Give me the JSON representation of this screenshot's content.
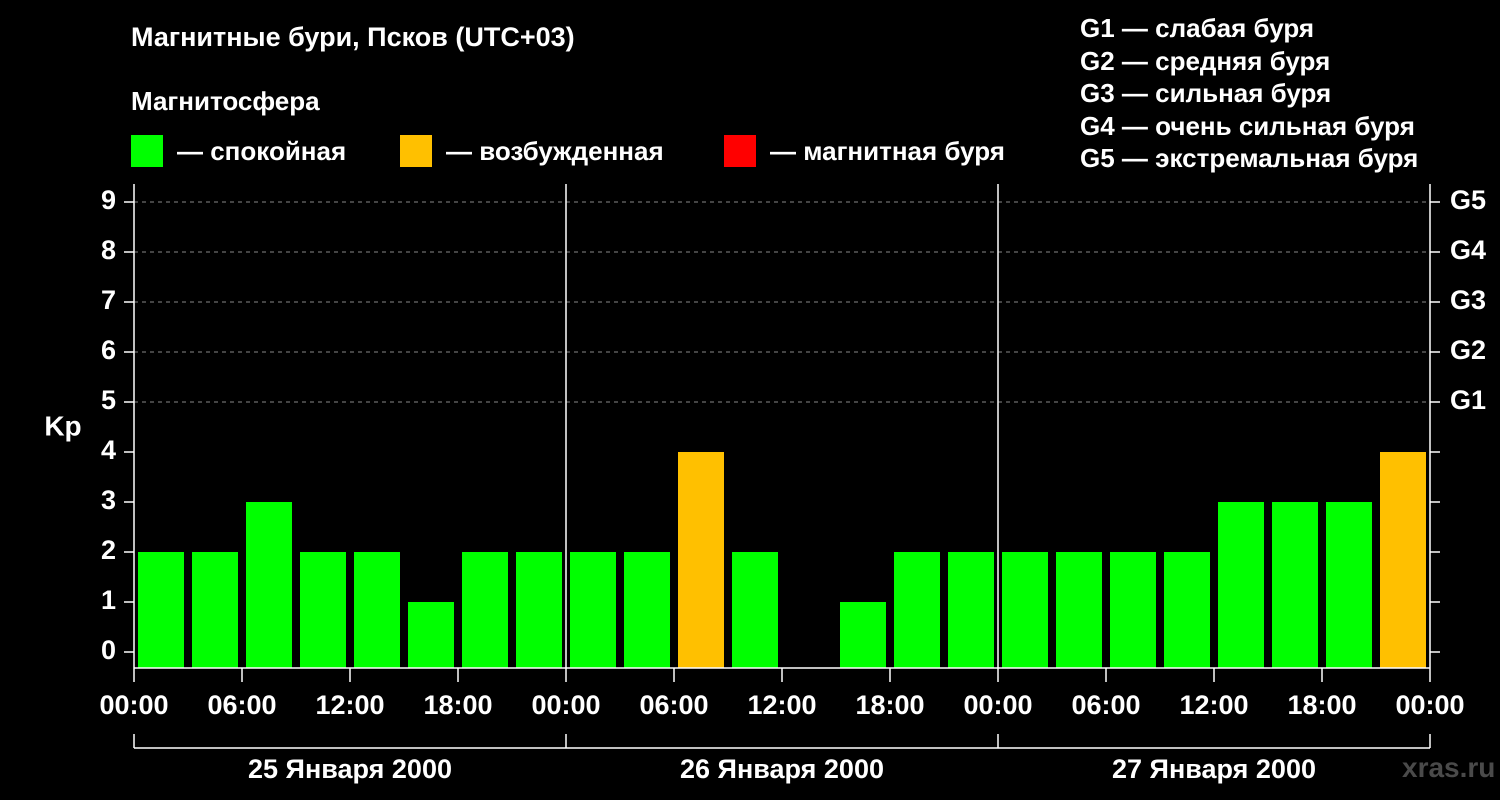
{
  "title": "Магнитные бури, Псков (UTC+03)",
  "subtitle": "Магнитосфера",
  "colors": {
    "background": "#000000",
    "calm": "#00ff00",
    "excited": "#ffc000",
    "storm": "#ff0000",
    "text": "#ffffff",
    "watermark": "#4a4a4a"
  },
  "legend": [
    {
      "label": "— спокойная",
      "color": "#00ff00"
    },
    {
      "label": "— возбужденная",
      "color": "#ffc000"
    },
    {
      "label": "— магнитная буря",
      "color": "#ff0000"
    }
  ],
  "storm_levels": [
    "G1 — слабая буря",
    "G2 — средняя буря",
    "G3 — сильная буря",
    "G4 — очень сильная буря",
    "G5 — экстремальная буря"
  ],
  "watermark": "xras.ru",
  "chart_data": {
    "type": "bar",
    "ylabel": "Kp",
    "ylim": [
      0,
      9
    ],
    "yticks": [
      "0",
      "1",
      "2",
      "3",
      "4",
      "5",
      "6",
      "7",
      "8",
      "9"
    ],
    "right_ticks": [
      {
        "value": 5,
        "label": "G1"
      },
      {
        "value": 6,
        "label": "G2"
      },
      {
        "value": 7,
        "label": "G3"
      },
      {
        "value": 8,
        "label": "G4"
      },
      {
        "value": 9,
        "label": "G5"
      }
    ],
    "grid": "horizontal dashed at Kp 5–9",
    "xticks": [
      "00:00",
      "06:00",
      "12:00",
      "18:00",
      "00:00",
      "06:00",
      "12:00",
      "18:00",
      "00:00",
      "06:00",
      "12:00",
      "18:00",
      "00:00"
    ],
    "days": [
      "25 Января 2000",
      "26 Января 2000",
      "27 Января 2000"
    ],
    "bar_interval_hours": 3,
    "values": [
      2,
      2,
      3,
      2,
      2,
      1,
      2,
      2,
      2,
      2,
      4,
      2,
      0,
      1,
      2,
      2,
      2,
      2,
      2,
      2,
      3,
      3,
      3,
      4
    ],
    "status": [
      "calm",
      "calm",
      "calm",
      "calm",
      "calm",
      "calm",
      "calm",
      "calm",
      "calm",
      "calm",
      "excited",
      "calm",
      "calm",
      "calm",
      "calm",
      "calm",
      "calm",
      "calm",
      "calm",
      "calm",
      "calm",
      "calm",
      "calm",
      "excited"
    ]
  }
}
